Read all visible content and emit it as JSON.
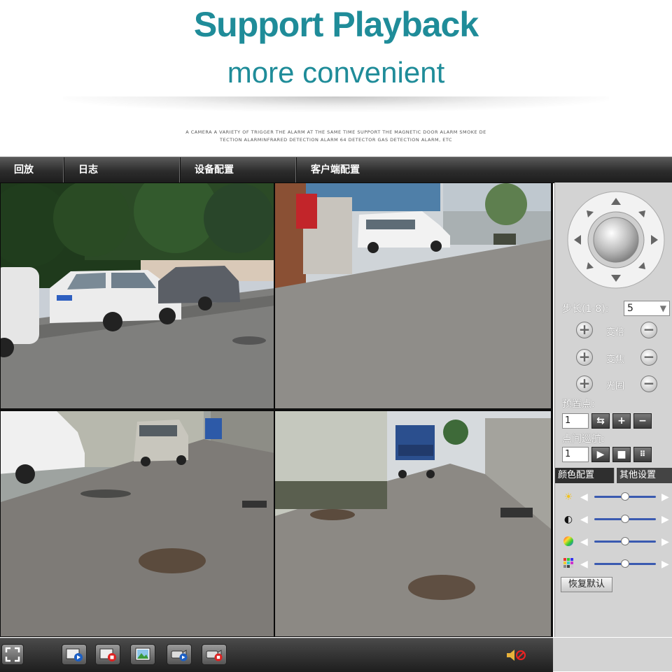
{
  "promo": {
    "title": "Support Playback",
    "subtitle": "more convenient",
    "caption_line1": "A CAMERA A VARIETY OF TRIGGER THE ALARM AT THE SAME TIME SUPPORT THE MAGNETIC DOOR ALARM SMOKE DE",
    "caption_line2": "TECTION ALARMINFRARED DETECTION ALARM 64 DETECTOR GAS DETECTION ALARM, ETC"
  },
  "menu": {
    "items": [
      {
        "label": "回放"
      },
      {
        "label": "日志"
      },
      {
        "label": "设备配置"
      },
      {
        "label": "客户端配置"
      }
    ]
  },
  "cameras": [
    {
      "scene": "parking-lot-trees-cars"
    },
    {
      "scene": "courtyard-white-van"
    },
    {
      "scene": "alley-parked-van-manhole"
    },
    {
      "scene": "alley-blue-truck-manholes"
    }
  ],
  "ptz": {
    "step_label": "步长(1-8):",
    "step_value": "5",
    "zoom_label": "变倍",
    "focus_label": "变焦",
    "iris_label": "光圈",
    "preset_label": "预置点:",
    "preset_value": "1",
    "cruise_label": "点间巡航:",
    "cruise_value": "1"
  },
  "tabs": {
    "color": "颜色配置",
    "other": "其他设置"
  },
  "color_sliders": [
    {
      "icon": "brightness-icon",
      "value": 0.5
    },
    {
      "icon": "contrast-icon",
      "value": 0.5
    },
    {
      "icon": "saturation-icon",
      "value": 0.5
    },
    {
      "icon": "hue-icon",
      "value": 0.5
    }
  ],
  "reset_label": "恢复默认",
  "accent_color": "#1f8c99",
  "slider_color": "#3a5ab0"
}
